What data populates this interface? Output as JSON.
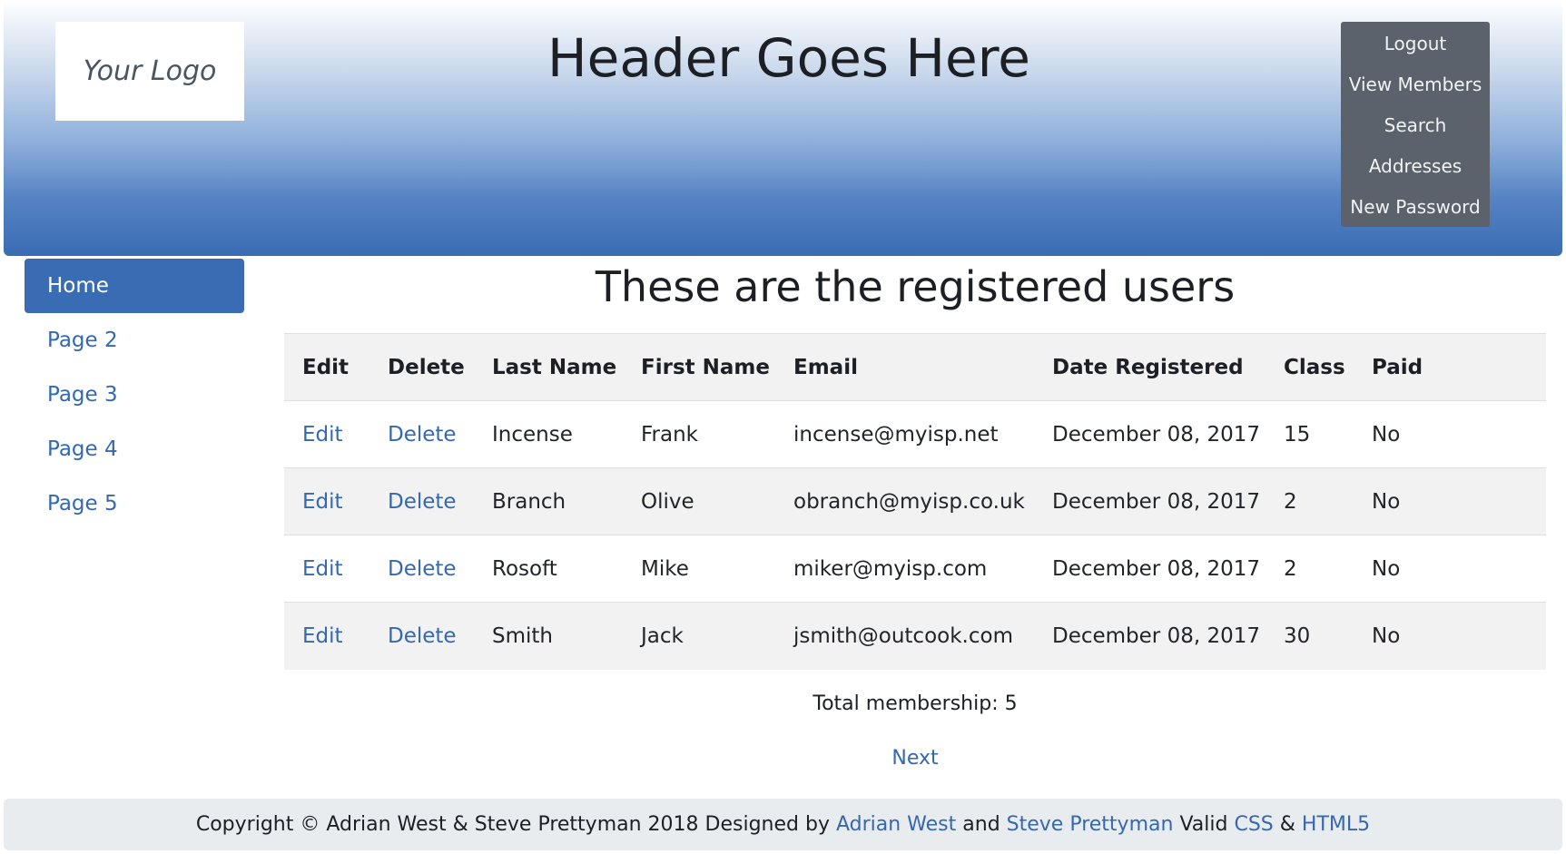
{
  "header": {
    "logo_text": "Your Logo",
    "title": "Header Goes Here",
    "menu": [
      "Logout",
      "View Members",
      "Search",
      "Addresses",
      "New Password"
    ]
  },
  "sidebar": {
    "items": [
      {
        "label": "Home",
        "active": true
      },
      {
        "label": "Page 2"
      },
      {
        "label": "Page 3"
      },
      {
        "label": "Page 4"
      },
      {
        "label": "Page 5"
      }
    ]
  },
  "main": {
    "title": "These are the registered users",
    "table": {
      "headers": [
        "Edit",
        "Delete",
        "Last Name",
        "First Name",
        "Email",
        "Date Registered",
        "Class",
        "Paid"
      ],
      "rows": [
        {
          "edit": "Edit",
          "delete": "Delete",
          "last_name": "Incense",
          "first_name": "Frank",
          "email": "incense@myisp.net",
          "date": "December 08, 2017",
          "class": "15",
          "paid": "No"
        },
        {
          "edit": "Edit",
          "delete": "Delete",
          "last_name": "Branch",
          "first_name": "Olive",
          "email": "obranch@myisp.co.uk",
          "date": "December 08, 2017",
          "class": "2",
          "paid": "No"
        },
        {
          "edit": "Edit",
          "delete": "Delete",
          "last_name": "Rosoft",
          "first_name": "Mike",
          "email": "miker@myisp.com",
          "date": "December 08, 2017",
          "class": "2",
          "paid": "No"
        },
        {
          "edit": "Edit",
          "delete": "Delete",
          "last_name": "Smith",
          "first_name": "Jack",
          "email": "jsmith@outcook.com",
          "date": "December 08, 2017",
          "class": "30",
          "paid": "No"
        }
      ]
    },
    "total": "Total membership: 5",
    "next": "Next"
  },
  "footer": {
    "prefix": "Copyright © Adrian West & Steve Prettyman 2018 Designed by",
    "author1": "Adrian West",
    "and": "and",
    "author2": "Steve Prettyman",
    "valid": "Valid",
    "css": "CSS",
    "amp": "&",
    "html5": "HTML5"
  },
  "colors": {
    "accent": "#3a6cb3",
    "link": "#3468b0",
    "menu_bg": "#5b626c"
  }
}
